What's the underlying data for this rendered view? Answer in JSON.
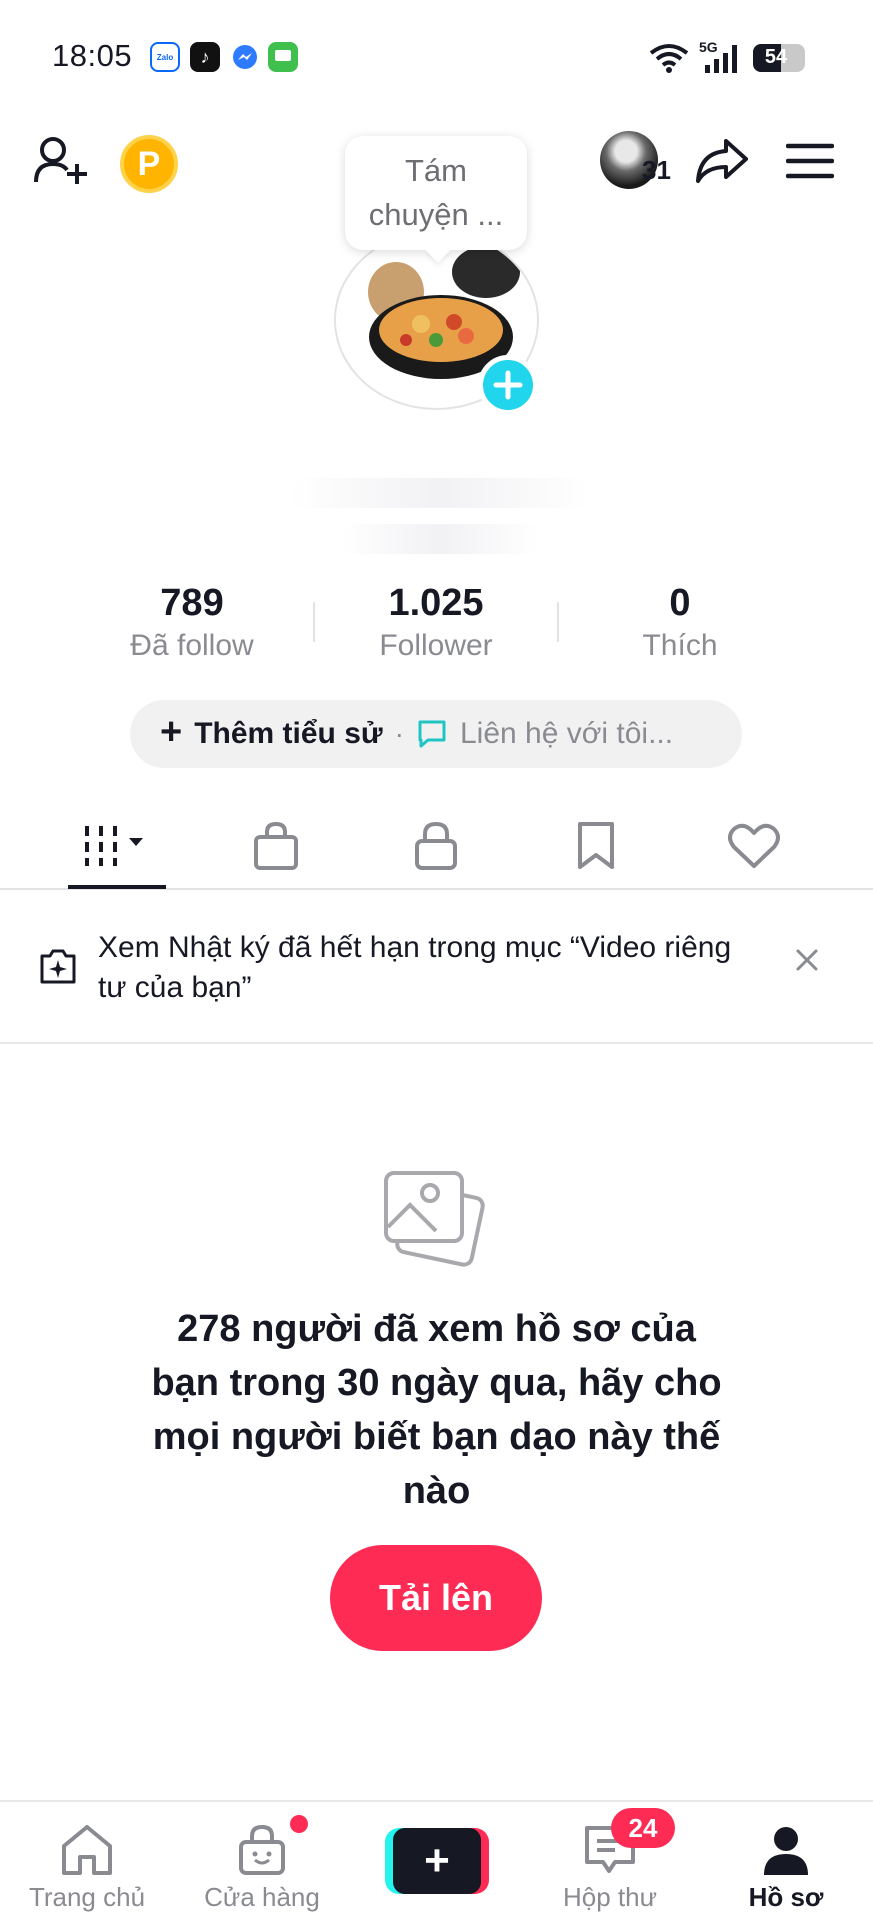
{
  "status_bar": {
    "time": "18:05",
    "network": "5G",
    "battery": "54",
    "battery_level": 0.54,
    "notification_icons": [
      "zalo-icon",
      "tiktok-icon",
      "messenger-icon",
      "messages-icon"
    ],
    "zalo_label": "Zalo"
  },
  "top_nav": {
    "coin_label": "P",
    "friends_count": "31",
    "icons": [
      "add-friend-icon",
      "coin-icon",
      "friend-avatar",
      "share-icon",
      "menu-icon"
    ]
  },
  "tooltip": {
    "line1": "Tám",
    "line2": "chuyện ..."
  },
  "stats": [
    {
      "value": "789",
      "label": "Đã follow"
    },
    {
      "value": "1.025",
      "label": "Follower"
    },
    {
      "value": "0",
      "label": "Thích"
    }
  ],
  "bio": {
    "add_label": "Thêm tiểu sử",
    "separator": "·",
    "contact_label": "Liên hệ với tôi..."
  },
  "tabs": {
    "active_index": 0,
    "items": [
      "videos-grid-icon",
      "shop-bag-icon",
      "lock-icon",
      "bookmark-icon",
      "heart-icon"
    ]
  },
  "banner": {
    "text": "Xem Nhật ký đã hết hạn trong mục “Video riêng tư của bạn”"
  },
  "empty_state": {
    "message": "278 người đã xem hồ sơ của bạn trong 30 ngày qua, hãy cho mọi người biết bạn dạo này thế nào",
    "upload_label": "Tải lên"
  },
  "bottom_nav": {
    "items": [
      {
        "label": "Trang chủ",
        "icon": "home-icon"
      },
      {
        "label": "Cửa hàng",
        "icon": "shop-icon"
      },
      {
        "label": "",
        "icon": "create-plus-icon"
      },
      {
        "label": "Hộp thư",
        "icon": "inbox-icon"
      },
      {
        "label": "Hồ sơ",
        "icon": "profile-icon"
      }
    ],
    "inbox_badge": "24",
    "active": "Hồ sơ"
  },
  "colors": {
    "accent": "#fe2c55",
    "cyan": "#20d5ec",
    "text": "#161823",
    "muted": "#8a8b91"
  }
}
